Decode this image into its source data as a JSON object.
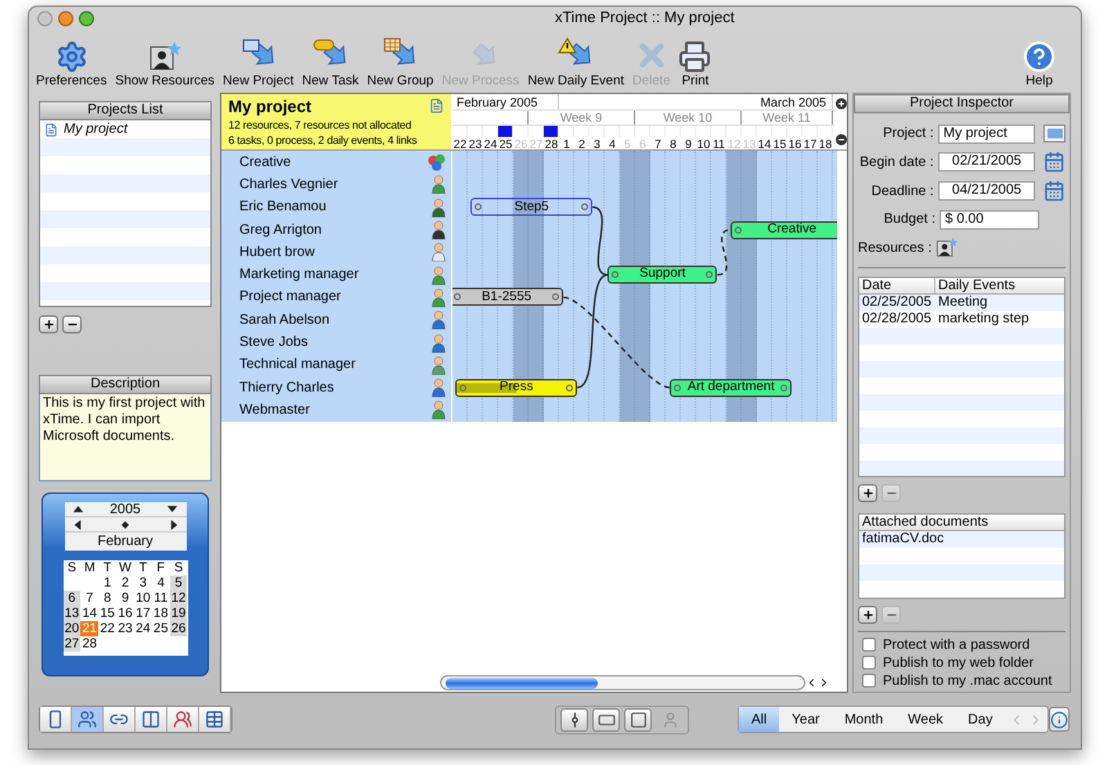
{
  "window": {
    "title": "xTime Project :: My project"
  },
  "toolbar": {
    "items": [
      {
        "label": "Preferences",
        "kind": "gears",
        "disabled": false
      },
      {
        "label": "Show Resources",
        "kind": "portrait",
        "disabled": false
      },
      {
        "label": "New Project",
        "kind": "book",
        "disabled": false
      },
      {
        "label": "New Task",
        "kind": "task",
        "disabled": false
      },
      {
        "label": "New Group",
        "kind": "grid",
        "disabled": false
      },
      {
        "label": "New Process",
        "kind": "process",
        "disabled": true
      },
      {
        "label": "New Daily Event",
        "kind": "event",
        "disabled": false
      },
      {
        "label": "Delete",
        "kind": "delete",
        "disabled": true
      },
      {
        "label": "Print",
        "kind": "printer",
        "disabled": false
      }
    ],
    "help": {
      "label": "Help"
    }
  },
  "projects_list": {
    "title": "Projects List",
    "items": [
      {
        "label": "My project",
        "selected": false
      }
    ],
    "remove_disabled": false
  },
  "description": {
    "title": "Description",
    "text": "This is my first project with xTime. I can import Microsoft documents."
  },
  "calendar": {
    "year": "2005",
    "month": "February",
    "weekdays": [
      "S",
      "M",
      "T",
      "W",
      "T",
      "F",
      "S"
    ],
    "weeks": [
      [
        {
          "label": "1",
          "selected": false
        },
        {
          "label": "2",
          "selected": false
        },
        {
          "label": "3",
          "selected": false
        },
        {
          "label": "4",
          "selected": false
        },
        {
          "label": "5",
          "selected": false
        }
      ],
      [
        {
          "label": "6",
          "selected": false
        },
        {
          "label": "7",
          "selected": false
        },
        {
          "label": "8",
          "selected": false
        },
        {
          "label": "9",
          "selected": false
        },
        {
          "label": "10",
          "selected": false
        },
        {
          "label": "11",
          "selected": false
        },
        {
          "label": "12",
          "selected": false
        }
      ],
      [
        {
          "label": "13",
          "selected": false
        },
        {
          "label": "14",
          "selected": false
        },
        {
          "label": "15",
          "selected": false
        },
        {
          "label": "16",
          "selected": false
        },
        {
          "label": "17",
          "selected": false
        },
        {
          "label": "18",
          "selected": false
        },
        {
          "label": "19",
          "selected": false
        }
      ],
      [
        {
          "label": "20",
          "selected": false
        },
        {
          "label": "21",
          "selected": true
        },
        {
          "label": "22",
          "selected": false
        },
        {
          "label": "23",
          "selected": false
        },
        {
          "label": "24",
          "selected": false
        },
        {
          "label": "25",
          "selected": false
        },
        {
          "label": "26",
          "selected": false
        }
      ],
      [
        {
          "label": "27",
          "selected": false
        },
        {
          "label": "28",
          "selected": false
        }
      ]
    ]
  },
  "project": {
    "title": "My project",
    "summary": [
      "12 resources, 7 resources not allocated",
      "6 tasks, 0 process, 2 daily events, 4 links"
    ]
  },
  "timeline": {
    "months": [
      {
        "label": "February 2005",
        "days": [
          {
            "label": "22",
            "weekend": false,
            "event": false
          },
          {
            "label": "23",
            "weekend": false,
            "event": false
          },
          {
            "label": "24",
            "weekend": false,
            "event": false
          },
          {
            "label": "25",
            "weekend": false,
            "event": true
          },
          {
            "label": "26",
            "weekend": true,
            "event": false
          },
          {
            "label": "27",
            "weekend": true,
            "event": false
          },
          {
            "label": "28",
            "weekend": false,
            "event": true
          }
        ]
      },
      {
        "label": "March 2005",
        "days": [
          {
            "label": "1",
            "weekend": false,
            "event": false
          },
          {
            "label": "2",
            "weekend": false,
            "event": false
          },
          {
            "label": "3",
            "weekend": false,
            "event": false
          },
          {
            "label": "4",
            "weekend": false,
            "event": false
          },
          {
            "label": "5",
            "weekend": true,
            "event": false
          },
          {
            "label": "6",
            "weekend": true,
            "event": false
          },
          {
            "label": "7",
            "weekend": false,
            "event": false
          },
          {
            "label": "8",
            "weekend": false,
            "event": false
          },
          {
            "label": "9",
            "weekend": false,
            "event": false
          },
          {
            "label": "10",
            "weekend": false,
            "event": false
          },
          {
            "label": "11",
            "weekend": false,
            "event": false
          },
          {
            "label": "12",
            "weekend": true,
            "event": false
          },
          {
            "label": "13",
            "weekend": true,
            "event": false
          },
          {
            "label": "14",
            "weekend": false,
            "event": false
          },
          {
            "label": "15",
            "weekend": false,
            "event": false
          },
          {
            "label": "16",
            "weekend": false,
            "event": false
          },
          {
            "label": "17",
            "weekend": false,
            "event": false
          },
          {
            "label": "18",
            "weekend": false,
            "event": false
          }
        ]
      }
    ],
    "weeks": [
      "Week 9",
      "Week 10",
      "Week 11"
    ]
  },
  "resources": [
    {
      "name": "Creative",
      "kind": "group"
    },
    {
      "name": "Charles Vegnier",
      "kind": "person",
      "color": "#3aa040"
    },
    {
      "name": "Eric Benamou",
      "kind": "person",
      "color": "#2e6b30",
      "tasks": [
        {
          "label": "Step5",
          "color": "#4040e0",
          "selected": true
        }
      ]
    },
    {
      "name": "Greg Arrigton",
      "kind": "person",
      "color": "#303030",
      "tasks": [
        {
          "label": "Creative",
          "color": "#40f088",
          "selected": false
        }
      ]
    },
    {
      "name": "Hubert brow",
      "kind": "person",
      "color": "#e8e8f0"
    },
    {
      "name": "Marketing manager",
      "kind": "person",
      "color": "#3aa040",
      "tasks": [
        {
          "label": "Support",
          "color": "#40f088",
          "selected": false
        }
      ]
    },
    {
      "name": "Project manager",
      "kind": "person",
      "color": "#3aa040",
      "tasks": [
        {
          "label": "B1-2555",
          "color": "#c8c8c8",
          "selected": false
        }
      ]
    },
    {
      "name": "Sarah Abelson",
      "kind": "person",
      "color": "#2a6fd0"
    },
    {
      "name": "Steve Jobs",
      "kind": "person",
      "color": "#2a6fd0"
    },
    {
      "name": "Technical manager",
      "kind": "person",
      "color": "#5aa060"
    },
    {
      "name": "Thierry Charles",
      "kind": "person",
      "color": "#2a6fd0",
      "tasks": [
        {
          "label": "Press",
          "color": "#f4f400",
          "selected": false,
          "level": 0.5
        },
        {
          "label": "Art department",
          "color": "#40f088",
          "selected": false
        }
      ]
    },
    {
      "name": "Webmaster",
      "kind": "person",
      "color": "#3aa040"
    }
  ],
  "inspector": {
    "title": "Project Inspector",
    "fields": [
      {
        "label": "Project :",
        "value": "My project",
        "kind": "color"
      },
      {
        "label": "Begin date :",
        "value": "02/21/2005",
        "kind": "date"
      },
      {
        "label": "Deadline :",
        "value": "04/21/2005",
        "kind": "date"
      },
      {
        "label": "Budget :",
        "value": "$ 0.00",
        "kind": "text"
      }
    ],
    "resources_label": "Resources :"
  },
  "daily_events": {
    "columns": [
      "Date",
      "Daily Events"
    ],
    "rows": [
      [
        "02/25/2005",
        "Meeting"
      ],
      [
        "02/28/2005",
        "marketing step"
      ]
    ],
    "remove_disabled": true
  },
  "attached_documents": {
    "title": "Attached documents",
    "items": [
      "fatimaCV.doc"
    ],
    "remove_disabled": true
  },
  "options": [
    {
      "label": "Protect with a password",
      "checked": false
    },
    {
      "label": "Publish to my web folder",
      "checked": false
    },
    {
      "label": "Publish to my .mac account",
      "checked": false
    }
  ],
  "bottom_bar": {
    "views": [
      {
        "kind": "page",
        "selected": false
      },
      {
        "kind": "gantt",
        "selected": true
      },
      {
        "kind": "links",
        "selected": false
      },
      {
        "kind": "split",
        "selected": false
      },
      {
        "kind": "people",
        "selected": false
      },
      {
        "kind": "table",
        "selected": false
      }
    ],
    "tools": [
      {
        "kind": "marker",
        "disabled": false
      },
      {
        "kind": "bar",
        "disabled": false
      },
      {
        "kind": "frame",
        "disabled": false
      },
      {
        "kind": "person",
        "disabled": true
      }
    ],
    "scales": [
      {
        "label": "All",
        "selected": true
      },
      {
        "label": "Year",
        "selected": false
      },
      {
        "label": "Month",
        "selected": false
      },
      {
        "label": "Week",
        "selected": false
      },
      {
        "label": "Day",
        "selected": false
      }
    ]
  }
}
